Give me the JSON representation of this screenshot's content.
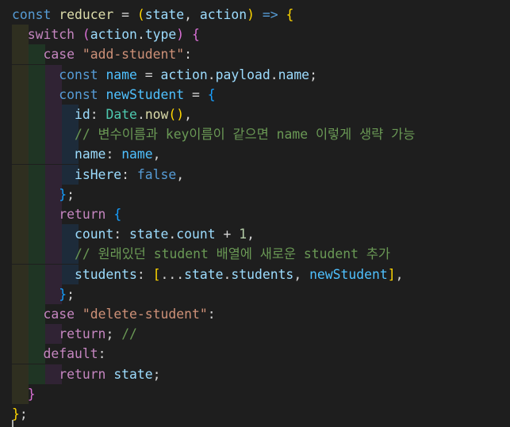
{
  "editor": {
    "theme": "dark",
    "colors": {
      "background": "#1e1e1e",
      "keyword": "#569cd6",
      "control": "#c586c0",
      "variable": "#9cdcfe",
      "constant": "#4fc1ff",
      "function": "#dcdcaa",
      "class": "#4ec9b0",
      "string": "#ce9178",
      "number": "#b5cea8",
      "comment": "#6a9955",
      "bracket_level1": "#ffd700",
      "bracket_level2": "#da70d6",
      "bracket_level3": "#179fff"
    },
    "lines": [
      [
        {
          "t": "const",
          "c": "kw"
        },
        {
          "t": " "
        },
        {
          "t": "reducer",
          "c": "fn"
        },
        {
          "t": " = "
        },
        {
          "t": "(",
          "c": "b1"
        },
        {
          "t": "state",
          "c": "var"
        },
        {
          "t": ", "
        },
        {
          "t": "action",
          "c": "var"
        },
        {
          "t": ")",
          "c": "b1"
        },
        {
          "t": " "
        },
        {
          "t": "=>",
          "c": "kw"
        },
        {
          "t": " "
        },
        {
          "t": "{",
          "c": "b1"
        }
      ],
      [
        {
          "t": "  "
        },
        {
          "t": "switch",
          "c": "ctl"
        },
        {
          "t": " "
        },
        {
          "t": "(",
          "c": "b2"
        },
        {
          "t": "action",
          "c": "var"
        },
        {
          "t": "."
        },
        {
          "t": "type",
          "c": "var"
        },
        {
          "t": ")",
          "c": "b2"
        },
        {
          "t": " "
        },
        {
          "t": "{",
          "c": "b2"
        }
      ],
      [
        {
          "t": "    "
        },
        {
          "t": "case",
          "c": "ctl"
        },
        {
          "t": " "
        },
        {
          "t": "\"add-student\"",
          "c": "str"
        },
        {
          "t": ":"
        }
      ],
      [
        {
          "t": "      "
        },
        {
          "t": "const",
          "c": "kw"
        },
        {
          "t": " "
        },
        {
          "t": "name",
          "c": "cst"
        },
        {
          "t": " = "
        },
        {
          "t": "action",
          "c": "var"
        },
        {
          "t": "."
        },
        {
          "t": "payload",
          "c": "var"
        },
        {
          "t": "."
        },
        {
          "t": "name",
          "c": "var"
        },
        {
          "t": ";"
        }
      ],
      [
        {
          "t": "      "
        },
        {
          "t": "const",
          "c": "kw"
        },
        {
          "t": " "
        },
        {
          "t": "newStudent",
          "c": "cst"
        },
        {
          "t": " = "
        },
        {
          "t": "{",
          "c": "b3"
        }
      ],
      [
        {
          "t": "        "
        },
        {
          "t": "id",
          "c": "var"
        },
        {
          "t": ": "
        },
        {
          "t": "Date",
          "c": "cls"
        },
        {
          "t": "."
        },
        {
          "t": "now",
          "c": "fn"
        },
        {
          "t": "()",
          "c": "b1"
        },
        {
          "t": ","
        }
      ],
      [
        {
          "t": "        "
        },
        {
          "t": "// 변수이름과 key이름이 같으면 name 이렇게 생략 가능",
          "c": "cmt"
        }
      ],
      [
        {
          "t": "        "
        },
        {
          "t": "name",
          "c": "var"
        },
        {
          "t": ": "
        },
        {
          "t": "name",
          "c": "cst"
        },
        {
          "t": ","
        }
      ],
      [
        {
          "t": "        "
        },
        {
          "t": "isHere",
          "c": "var"
        },
        {
          "t": ": "
        },
        {
          "t": "false",
          "c": "kw"
        },
        {
          "t": ","
        }
      ],
      [
        {
          "t": "      "
        },
        {
          "t": "}",
          "c": "b3"
        },
        {
          "t": ";"
        }
      ],
      [
        {
          "t": "      "
        },
        {
          "t": "return",
          "c": "ctl"
        },
        {
          "t": " "
        },
        {
          "t": "{",
          "c": "b3"
        }
      ],
      [
        {
          "t": "        "
        },
        {
          "t": "count",
          "c": "var"
        },
        {
          "t": ": "
        },
        {
          "t": "state",
          "c": "var"
        },
        {
          "t": "."
        },
        {
          "t": "count",
          "c": "var"
        },
        {
          "t": " + "
        },
        {
          "t": "1",
          "c": "num"
        },
        {
          "t": ","
        }
      ],
      [
        {
          "t": "        "
        },
        {
          "t": "// 원래있던 student 배열에 새로운 student 추가",
          "c": "cmt"
        }
      ],
      [
        {
          "t": "        "
        },
        {
          "t": "students",
          "c": "var"
        },
        {
          "t": ": "
        },
        {
          "t": "[",
          "c": "b1"
        },
        {
          "t": "..."
        },
        {
          "t": "state",
          "c": "var"
        },
        {
          "t": "."
        },
        {
          "t": "students",
          "c": "var"
        },
        {
          "t": ", "
        },
        {
          "t": "newStudent",
          "c": "cst"
        },
        {
          "t": "]",
          "c": "b1"
        },
        {
          "t": ","
        }
      ],
      [
        {
          "t": "      "
        },
        {
          "t": "}",
          "c": "b3"
        },
        {
          "t": ";"
        }
      ],
      [
        {
          "t": "    "
        },
        {
          "t": "case",
          "c": "ctl"
        },
        {
          "t": " "
        },
        {
          "t": "\"delete-student\"",
          "c": "str"
        },
        {
          "t": ":"
        }
      ],
      [
        {
          "t": "      "
        },
        {
          "t": "return",
          "c": "ctl"
        },
        {
          "t": "; "
        },
        {
          "t": "//",
          "c": "cmt"
        }
      ],
      [
        {
          "t": "    "
        },
        {
          "t": "default",
          "c": "ctl"
        },
        {
          "t": ":"
        }
      ],
      [
        {
          "t": "      "
        },
        {
          "t": "return",
          "c": "ctl"
        },
        {
          "t": " "
        },
        {
          "t": "state",
          "c": "var"
        },
        {
          "t": ";"
        }
      ],
      [
        {
          "t": "  "
        },
        {
          "t": "}",
          "c": "b2"
        }
      ],
      [
        {
          "t": "}",
          "c": "b1"
        },
        {
          "t": ";"
        }
      ]
    ]
  }
}
